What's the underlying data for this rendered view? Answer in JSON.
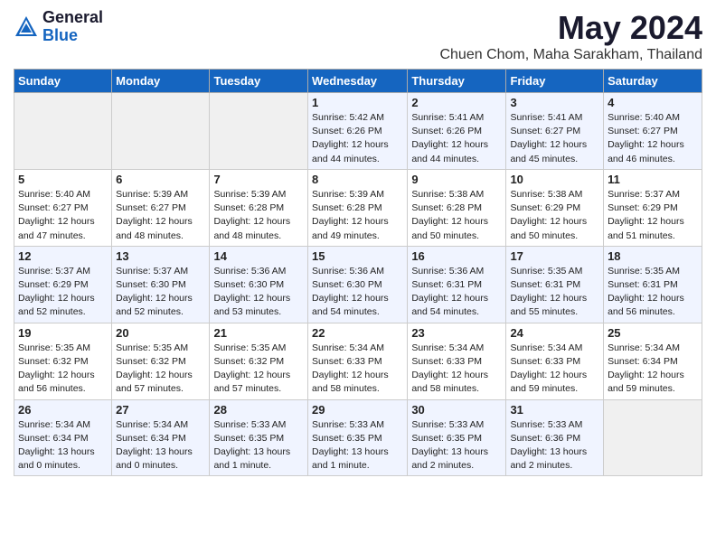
{
  "header": {
    "logo": {
      "general": "General",
      "blue": "Blue"
    },
    "title": "May 2024",
    "location": "Chuen Chom, Maha Sarakham, Thailand"
  },
  "weekdays": [
    "Sunday",
    "Monday",
    "Tuesday",
    "Wednesday",
    "Thursday",
    "Friday",
    "Saturday"
  ],
  "weeks": [
    [
      {
        "day": "",
        "empty": true
      },
      {
        "day": "",
        "empty": true
      },
      {
        "day": "",
        "empty": true
      },
      {
        "day": "1",
        "sunrise": "5:42 AM",
        "sunset": "6:26 PM",
        "daylight": "12 hours and 44 minutes."
      },
      {
        "day": "2",
        "sunrise": "5:41 AM",
        "sunset": "6:26 PM",
        "daylight": "12 hours and 44 minutes."
      },
      {
        "day": "3",
        "sunrise": "5:41 AM",
        "sunset": "6:27 PM",
        "daylight": "12 hours and 45 minutes."
      },
      {
        "day": "4",
        "sunrise": "5:40 AM",
        "sunset": "6:27 PM",
        "daylight": "12 hours and 46 minutes."
      }
    ],
    [
      {
        "day": "5",
        "sunrise": "5:40 AM",
        "sunset": "6:27 PM",
        "daylight": "12 hours and 47 minutes."
      },
      {
        "day": "6",
        "sunrise": "5:39 AM",
        "sunset": "6:27 PM",
        "daylight": "12 hours and 48 minutes."
      },
      {
        "day": "7",
        "sunrise": "5:39 AM",
        "sunset": "6:28 PM",
        "daylight": "12 hours and 48 minutes."
      },
      {
        "day": "8",
        "sunrise": "5:39 AM",
        "sunset": "6:28 PM",
        "daylight": "12 hours and 49 minutes."
      },
      {
        "day": "9",
        "sunrise": "5:38 AM",
        "sunset": "6:28 PM",
        "daylight": "12 hours and 50 minutes."
      },
      {
        "day": "10",
        "sunrise": "5:38 AM",
        "sunset": "6:29 PM",
        "daylight": "12 hours and 50 minutes."
      },
      {
        "day": "11",
        "sunrise": "5:37 AM",
        "sunset": "6:29 PM",
        "daylight": "12 hours and 51 minutes."
      }
    ],
    [
      {
        "day": "12",
        "sunrise": "5:37 AM",
        "sunset": "6:29 PM",
        "daylight": "12 hours and 52 minutes."
      },
      {
        "day": "13",
        "sunrise": "5:37 AM",
        "sunset": "6:30 PM",
        "daylight": "12 hours and 52 minutes."
      },
      {
        "day": "14",
        "sunrise": "5:36 AM",
        "sunset": "6:30 PM",
        "daylight": "12 hours and 53 minutes."
      },
      {
        "day": "15",
        "sunrise": "5:36 AM",
        "sunset": "6:30 PM",
        "daylight": "12 hours and 54 minutes."
      },
      {
        "day": "16",
        "sunrise": "5:36 AM",
        "sunset": "6:31 PM",
        "daylight": "12 hours and 54 minutes."
      },
      {
        "day": "17",
        "sunrise": "5:35 AM",
        "sunset": "6:31 PM",
        "daylight": "12 hours and 55 minutes."
      },
      {
        "day": "18",
        "sunrise": "5:35 AM",
        "sunset": "6:31 PM",
        "daylight": "12 hours and 56 minutes."
      }
    ],
    [
      {
        "day": "19",
        "sunrise": "5:35 AM",
        "sunset": "6:32 PM",
        "daylight": "12 hours and 56 minutes."
      },
      {
        "day": "20",
        "sunrise": "5:35 AM",
        "sunset": "6:32 PM",
        "daylight": "12 hours and 57 minutes."
      },
      {
        "day": "21",
        "sunrise": "5:35 AM",
        "sunset": "6:32 PM",
        "daylight": "12 hours and 57 minutes."
      },
      {
        "day": "22",
        "sunrise": "5:34 AM",
        "sunset": "6:33 PM",
        "daylight": "12 hours and 58 minutes."
      },
      {
        "day": "23",
        "sunrise": "5:34 AM",
        "sunset": "6:33 PM",
        "daylight": "12 hours and 58 minutes."
      },
      {
        "day": "24",
        "sunrise": "5:34 AM",
        "sunset": "6:33 PM",
        "daylight": "12 hours and 59 minutes."
      },
      {
        "day": "25",
        "sunrise": "5:34 AM",
        "sunset": "6:34 PM",
        "daylight": "12 hours and 59 minutes."
      }
    ],
    [
      {
        "day": "26",
        "sunrise": "5:34 AM",
        "sunset": "6:34 PM",
        "daylight": "13 hours and 0 minutes."
      },
      {
        "day": "27",
        "sunrise": "5:34 AM",
        "sunset": "6:34 PM",
        "daylight": "13 hours and 0 minutes."
      },
      {
        "day": "28",
        "sunrise": "5:33 AM",
        "sunset": "6:35 PM",
        "daylight": "13 hours and 1 minute."
      },
      {
        "day": "29",
        "sunrise": "5:33 AM",
        "sunset": "6:35 PM",
        "daylight": "13 hours and 1 minute."
      },
      {
        "day": "30",
        "sunrise": "5:33 AM",
        "sunset": "6:35 PM",
        "daylight": "13 hours and 2 minutes."
      },
      {
        "day": "31",
        "sunrise": "5:33 AM",
        "sunset": "6:36 PM",
        "daylight": "13 hours and 2 minutes."
      },
      {
        "day": "",
        "empty": true
      }
    ]
  ],
  "labels": {
    "sunrise": "Sunrise:",
    "sunset": "Sunset:",
    "daylight": "Daylight:"
  }
}
